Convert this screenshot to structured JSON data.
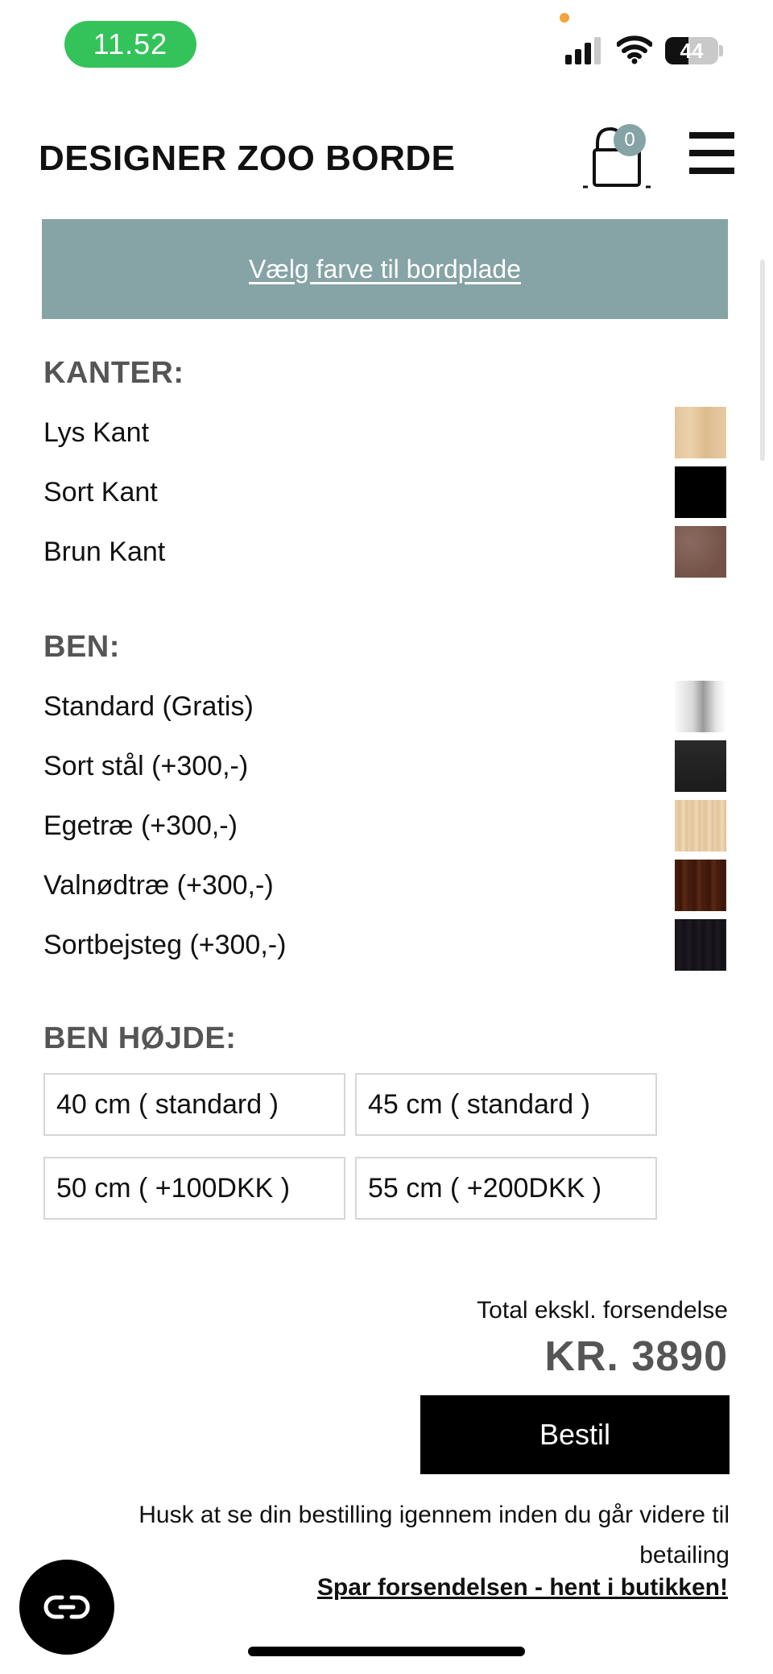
{
  "status_bar": {
    "time": "11.52",
    "battery_label": "44",
    "battery_level": 0.44,
    "privacy_indicator_color": "#f3a33a"
  },
  "header": {
    "title": "DESIGNER ZOO BORDE",
    "cart_count": "0",
    "cart_icon": "shopping-bag-icon",
    "menu_icon": "hamburger-menu-icon"
  },
  "color_banner": {
    "link_text": "Vælg farve til bordplade",
    "background": "#86a3a5"
  },
  "edges": {
    "heading": "KANTER:",
    "options": [
      {
        "label": "Lys Kant",
        "swatch": "light-wood"
      },
      {
        "label": "Sort Kant",
        "swatch": "black"
      },
      {
        "label": "Brun Kant",
        "swatch": "brown"
      }
    ]
  },
  "legs": {
    "heading": "BEN:",
    "options": [
      {
        "label": "Standard (Gratis)",
        "swatch": "chrome"
      },
      {
        "label": "Sort stål (+300,-)",
        "swatch": "black-steel"
      },
      {
        "label": "Egetræ (+300,-)",
        "swatch": "oak"
      },
      {
        "label": "Valnødtræ (+300,-)",
        "swatch": "walnut"
      },
      {
        "label": "Sortbejsteg (+300,-)",
        "swatch": "black-stained-oak"
      }
    ]
  },
  "leg_height": {
    "heading": "BEN HØJDE:",
    "options": [
      "40 cm ( standard )",
      "45 cm ( standard )",
      "50 cm ( +100DKK )",
      "55 cm ( +200DKK )"
    ]
  },
  "summary": {
    "total_label": "Total ekskl. forsendelse",
    "total_price": "KR. 3890",
    "order_button": "Bestil",
    "review_note": "Husk at se din bestilling igennem inden du går videre til betailing",
    "pickup_link": "Spar forsendelsen - hent i butikken!"
  },
  "chat": {
    "icon": "chat-link-icon"
  }
}
